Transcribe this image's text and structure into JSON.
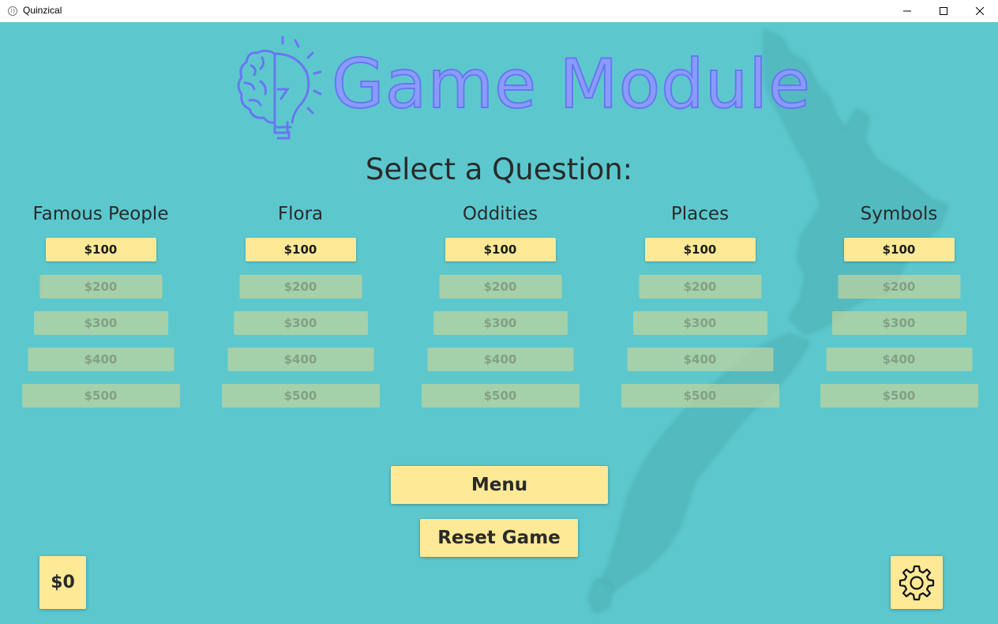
{
  "window": {
    "title": "Quinzical",
    "icon": "brain-icon",
    "controls": [
      "minimize-icon",
      "maximize-icon",
      "close-icon"
    ]
  },
  "header": {
    "title": "Game Module",
    "logo": "brain-lightbulb-icon"
  },
  "prompt": "Select a Question:",
  "categories": [
    {
      "name": "Famous People",
      "prices": [
        "$100",
        "$200",
        "$300",
        "$400",
        "$500"
      ]
    },
    {
      "name": "Flora",
      "prices": [
        "$100",
        "$200",
        "$300",
        "$400",
        "$500"
      ]
    },
    {
      "name": "Oddities",
      "prices": [
        "$100",
        "$200",
        "$300",
        "$400",
        "$500"
      ]
    },
    {
      "name": "Places",
      "prices": [
        "$100",
        "$200",
        "$300",
        "$400",
        "$500"
      ]
    },
    {
      "name": "Symbols",
      "prices": [
        "$100",
        "$200",
        "$300",
        "$400",
        "$500"
      ]
    }
  ],
  "active_price_index": 0,
  "buttons": {
    "menu": "Menu",
    "reset": "Reset Game"
  },
  "score": "$0",
  "settings_icon": "gear-icon",
  "colors": {
    "background": "#5cc8ce",
    "button": "#fde996",
    "title": "#8a9bff",
    "disabled_button": "#c0d29c"
  }
}
